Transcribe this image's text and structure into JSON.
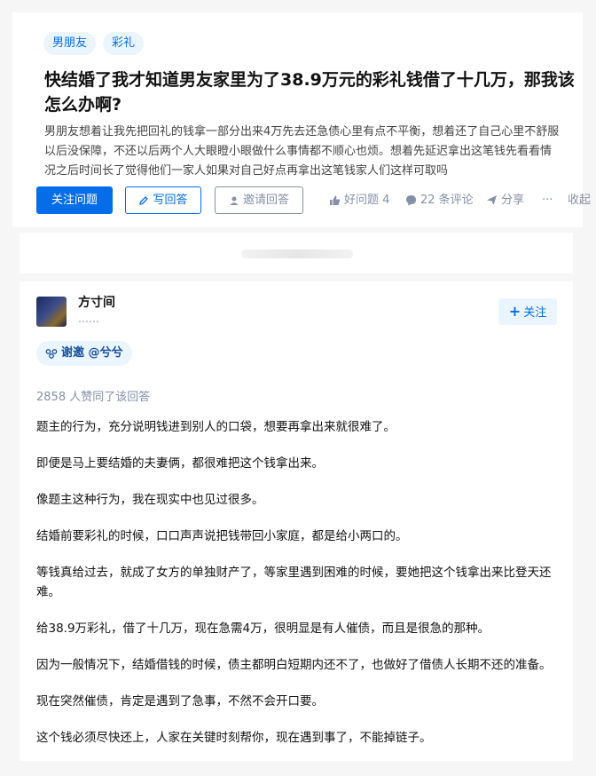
{
  "question": {
    "tags": [
      "男朋友",
      "彩礼"
    ],
    "title": "快结婚了我才知道男友家里为了38.9万元的彩礼钱借了十几万，那我该怎么办啊?",
    "description_lines": [
      "男朋友想着让我先把回礼的钱拿一部分出来4万先去还急债心里有点不平衡，想着还了自己心里不舒服",
      "以后没保障，不还以后两个人大眼瞪小眼做什么事情都不顺心也烦。想着先延迟拿出这笔钱先看看情",
      "况之后时间长了觉得他们一家人如果对自己好点再拿出这笔钱家人们这样可取吗"
    ],
    "actions": {
      "follow_label": "关注问题",
      "write_label": "写回答",
      "invite_label": "邀请回答",
      "like_label": "好问题 4",
      "comments_label": "22 条评论",
      "share_label": "分享",
      "more_label": "···",
      "collapse_label": "收起"
    }
  },
  "answer": {
    "author_name": "方寸间",
    "author_bio": "……",
    "follow_label": "关注",
    "invite_badge": "谢邀 @兮兮",
    "likes_text": "2858 人赞同了该回答",
    "paragraphs": [
      "题主的行为，充分说明钱进到别人的口袋，想要再拿出来就很难了。",
      "即便是马上要结婚的夫妻俩，都很难把这个钱拿出来。",
      "像题主这种行为，我在现实中也见过很多。",
      "结婚前要彩礼的时候，口口声声说把钱带回小家庭，都是给小两口的。",
      "等钱真给过去，就成了女方的单独财产了，等家里遇到困难的时候，要她把这个钱拿出来比登天还难。",
      "给38.9万彩礼，借了十几万，现在急需4万，很明显是有人催债，而且是很急的那种。",
      "因为一般情况下，结婚借钱的时候，债主都明白短期内还不了，也做好了借债人长期不还的准备。",
      "现在突然催债，肯定是遇到了急事，不然不会开口要。",
      "这个钱必须尽快还上，人家在关键时刻帮你，现在遇到事了，不能掉链子。"
    ]
  },
  "colors": {
    "brand": "#056de8",
    "tag_bg": "#ebf5ff",
    "muted": "#8590a6"
  },
  "icons": [
    "pen-icon",
    "invite-person-icon",
    "thumbs-up-icon",
    "comment-bubble-icon",
    "share-arrow-icon",
    "plus-icon",
    "invite-link-icon"
  ]
}
